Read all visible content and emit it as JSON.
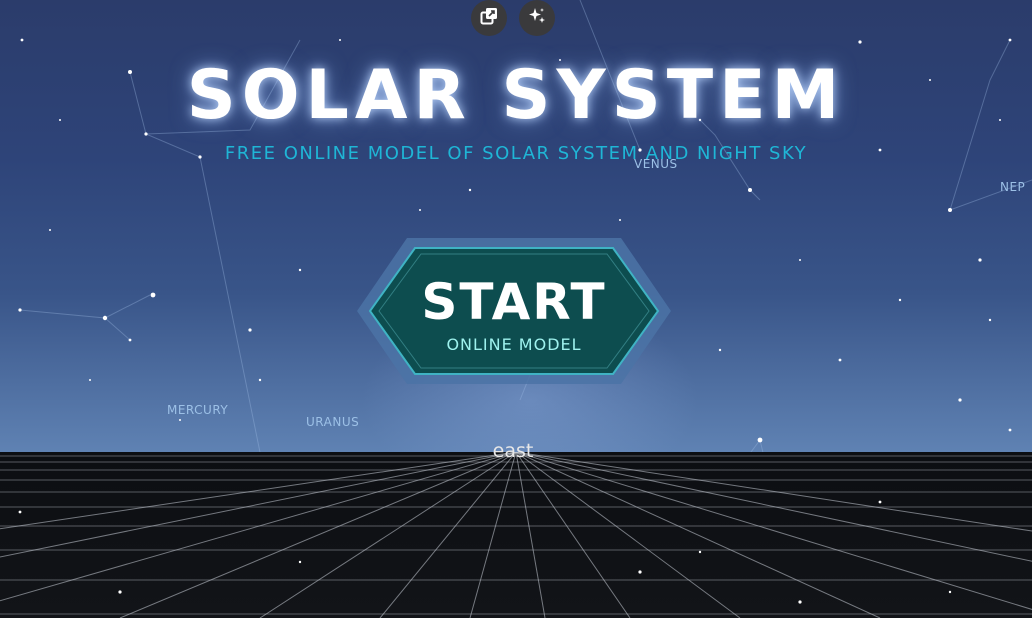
{
  "header": {
    "title": "SOLAR SYSTEM",
    "subtitle": "FREE ONLINE MODEL OF SOLAR SYSTEM AND NIGHT SKY"
  },
  "toolbar": {
    "buttons": [
      {
        "name": "open-external",
        "icon": "open-external-icon"
      },
      {
        "name": "ai-sparkle",
        "icon": "sparkle-icon"
      }
    ]
  },
  "start_button": {
    "label": "START",
    "sublabel": "ONLINE MODEL"
  },
  "sky_labels": {
    "venus": "VENUS",
    "neptune": "NEP",
    "mercury": "MERCURY",
    "uranus": "URANUS"
  },
  "compass": {
    "direction": "east"
  },
  "colors": {
    "title": "#ffffff",
    "subtitle": "#1fb6d6",
    "button_fill": "#0d4d4f",
    "button_border": "#6aa2c8",
    "button_sublabel": "#9ef2ee",
    "planet_label": "#9cc0e6"
  }
}
